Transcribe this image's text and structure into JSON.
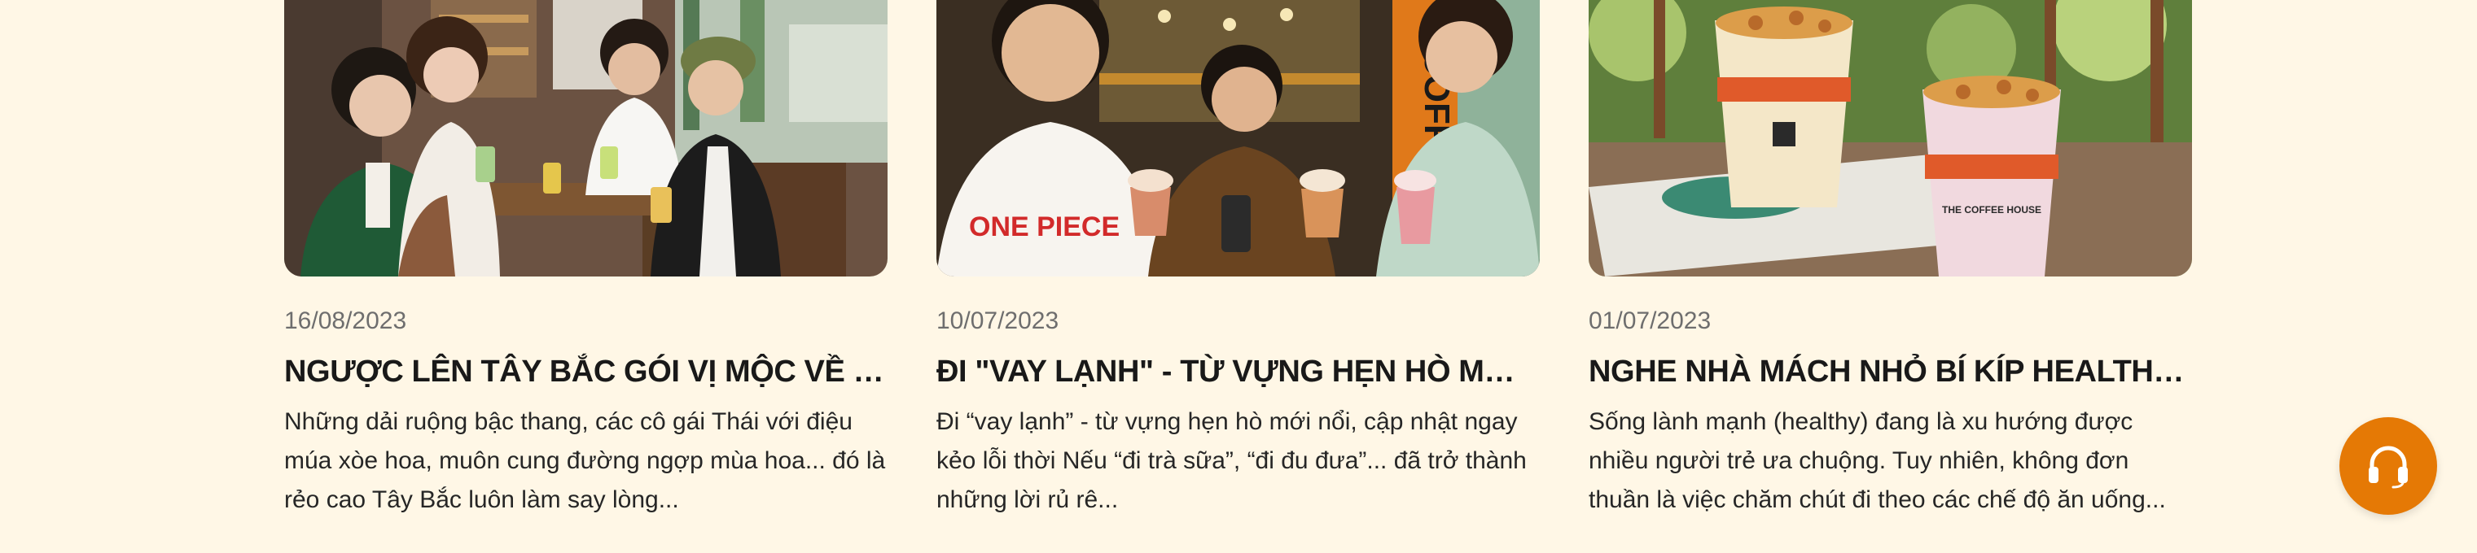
{
  "articles": [
    {
      "date": "16/08/2023",
      "title": "NGƯỢC LÊN TÂY BẮC GÓI VỊ MỘC VỀ XUÔI",
      "excerpt": "Những dải ruộng bậc thang, các cô gái Thái với điệu múa xòe hoa, muôn cung đường ngợp mùa hoa... đó là rẻo cao Tây Bắc luôn làm say lòng..."
    },
    {
      "date": "10/07/2023",
      "title": "ĐI \"VAY LẠNH\" - TỪ VỰNG HẸN HÒ MỚI NỔI CỦA GIỚI TRẺ",
      "excerpt": "Đi “vay lạnh” - từ vựng hẹn hò mới nổi, cập nhật ngay kẻo lỗi thời  Nếu “đi trà sữa”, “đi đu đưa”... đã trở thành những lời rủ rê..."
    },
    {
      "date": "01/07/2023",
      "title": "NGHE NHÀ MÁCH NHỎ BÍ KÍP HEALTHY GỌN NHẸ",
      "excerpt": "Sống lành mạnh (healthy) đang là xu hướng được nhiều người trẻ ưa chuộng. Tuy nhiên, không đơn thuần là việc chăm chút đi theo các chế độ ăn uống..."
    }
  ],
  "shirt_print": "ONE PIECE",
  "cup_brand": "THE COFFEE HOUSE",
  "support_icon": "headset-icon",
  "colors": {
    "background": "#fff7e6",
    "accent": "#e57905",
    "title": "#191919",
    "date": "#6e6e6e"
  }
}
